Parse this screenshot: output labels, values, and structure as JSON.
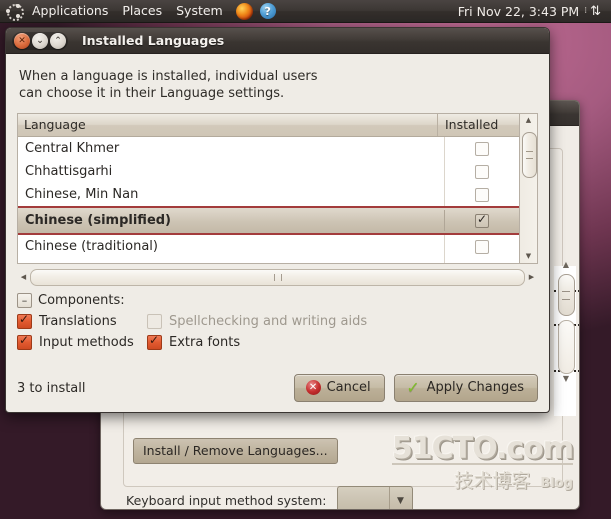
{
  "panel": {
    "logo_icon": "ubuntu-logo-icon",
    "menus": [
      "Applications",
      "Places",
      "System"
    ],
    "firefox_icon": "firefox-icon",
    "help_icon": "help-icon",
    "help_glyph": "?",
    "clock": "Fri Nov 22,  3:43 PM",
    "indicator_glyph": "⁞",
    "network_icon": "network-updown-icon",
    "network_glyph": "⇅"
  },
  "dialog": {
    "title": "Installed Languages",
    "window_controls": {
      "close_glyph": "✕",
      "minimize_glyph": "⌄",
      "maximize_glyph": "⌃"
    },
    "intro": "When a language is installed, individual users\ncan choose it in their Language settings.",
    "list": {
      "columns": [
        "Language",
        "Installed"
      ],
      "rows": [
        {
          "language": "Central Khmer",
          "installed": false,
          "selected": false
        },
        {
          "language": "Chhattisgarhi",
          "installed": false,
          "selected": false
        },
        {
          "language": "Chinese, Min Nan",
          "installed": false,
          "selected": false
        },
        {
          "language": "Chinese (simplified)",
          "installed": true,
          "selected": true
        },
        {
          "language": "Chinese (traditional)",
          "installed": false,
          "selected": false
        }
      ]
    },
    "components": {
      "label": "Components:",
      "expander_glyph": "–",
      "items": [
        {
          "label": "Translations",
          "checked": true,
          "enabled": true
        },
        {
          "label": "Spellchecking and writing aids",
          "checked": false,
          "enabled": false
        },
        {
          "label": "Input methods",
          "checked": true,
          "enabled": true
        },
        {
          "label": "Extra fonts",
          "checked": true,
          "enabled": true
        }
      ]
    },
    "footer": {
      "status": "3 to install",
      "cancel_label": "Cancel",
      "cancel_glyph": "✕",
      "apply_label": "Apply Changes",
      "apply_glyph": "✓"
    }
  },
  "background_window": {
    "install_button": "Install / Remove Languages...",
    "keyboard_label": "Keyboard input method system:",
    "combo_value": "",
    "combo_arrow_glyph": "▼",
    "scroll_up_glyph": "▲",
    "scroll_down_glyph": "▼"
  },
  "watermark": {
    "main": "51CTO.com",
    "cn": "技术博客",
    "blog": "Blog"
  },
  "colors": {
    "accent_orange": "#e15a30",
    "selection_border": "#a33c3c",
    "panel_bg": "#3c3734",
    "dialog_bg": "#efece6"
  }
}
